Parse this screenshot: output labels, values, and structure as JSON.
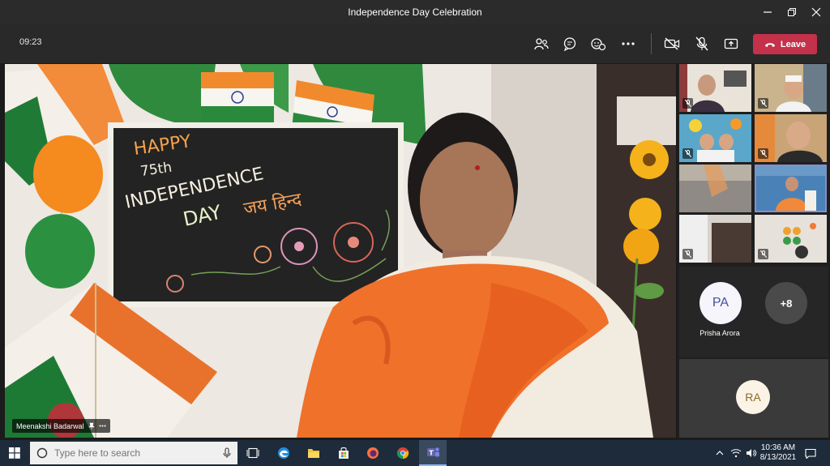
{
  "window": {
    "title": "Independence Day Celebration"
  },
  "toolbar": {
    "timer": "09:23",
    "leave_label": "Leave"
  },
  "stage": {
    "speaker_name": "Meenakshi Badarwal",
    "board_lines": [
      "HAPPY",
      "75th",
      "INDEPENDENCE",
      "DAY",
      "जय हिन्द"
    ]
  },
  "gallery": {
    "tiles": [
      {
        "initials": "PA",
        "name": "Prisha Arora"
      },
      {
        "overflow": "+8"
      },
      {
        "initials": "RA"
      }
    ]
  },
  "taskbar": {
    "search_placeholder": "Type here to search",
    "time": "10:36 AM",
    "date": "8/13/2021"
  },
  "colors": {
    "leave": "#c4314b",
    "saffron": "#ff8a2a",
    "flag_green": "#138a36",
    "teams_purple": "#6264a7"
  }
}
